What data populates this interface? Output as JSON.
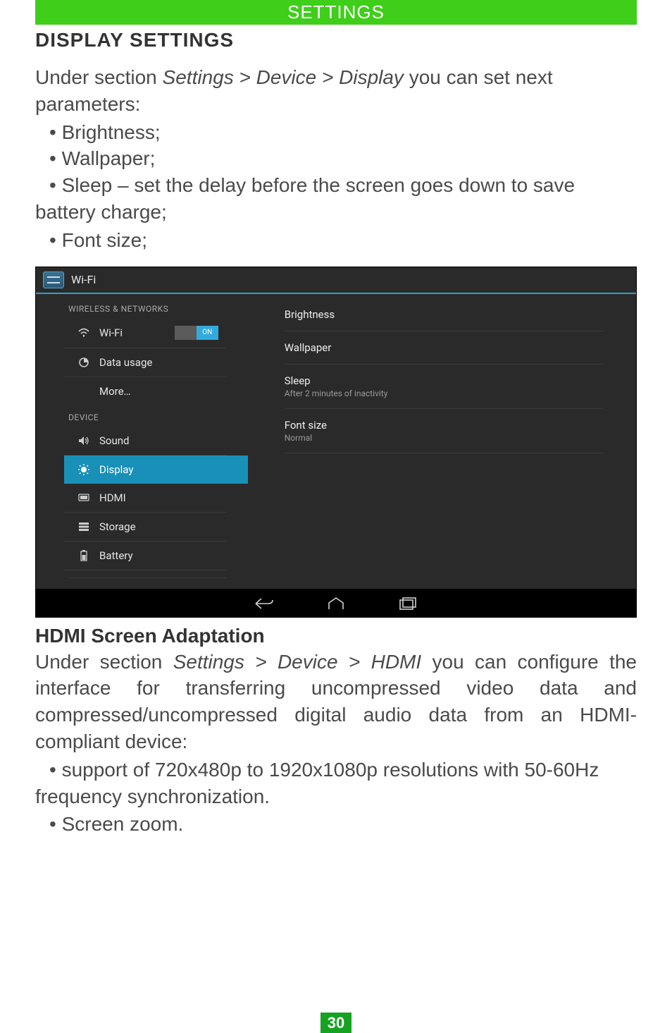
{
  "header": "SETTINGS",
  "section_title": "DISPLAY SETTINGS",
  "intro_pre": "Under section ",
  "intro_breadcrumb": "Settings > Device > Display",
  "intro_post": " you can set next parameters:",
  "bullets_top": [
    "Brightness;",
    "Wallpaper;",
    "Sleep – set the delay before the screen goes down to save battery charge;",
    "Font size;"
  ],
  "screenshot": {
    "title": "Wi-Fi",
    "categories": {
      "wireless_label": "WIRELESS & NETWORKS",
      "device_label": "DEVICE"
    },
    "wireless_items": [
      {
        "label": "Wi-Fi",
        "icon": "wifi",
        "toggle": "ON"
      },
      {
        "label": "Data usage",
        "icon": "data"
      },
      {
        "label": "More…",
        "icon": ""
      }
    ],
    "device_items": [
      {
        "label": "Sound",
        "icon": "sound"
      },
      {
        "label": "Display",
        "icon": "display",
        "selected": true
      },
      {
        "label": "HDMI",
        "icon": "hdmi"
      },
      {
        "label": "Storage",
        "icon": "storage"
      },
      {
        "label": "Battery",
        "icon": "battery"
      }
    ],
    "right_items": [
      {
        "title": "Brightness"
      },
      {
        "title": "Wallpaper"
      },
      {
        "title": "Sleep",
        "sub": "After 2 minutes of inactivity"
      },
      {
        "title": "Font size",
        "sub": "Normal"
      }
    ]
  },
  "sub_heading": "HDMI Screen Adaptation",
  "hdmi_intro_pre": "Under section ",
  "hdmi_breadcrumb": "Settings > Device > HDMI",
  "hdmi_intro_post": " you can configure the interface for transferring uncompressed video data and compressed/uncompressed digital audio data from an HDMI-compliant device:",
  "bullets_bottom": [
    "support of 720x480p to 1920x1080p resolutions with 50-60Hz frequency synchronization.",
    "Screen zoom."
  ],
  "page_number": "30"
}
